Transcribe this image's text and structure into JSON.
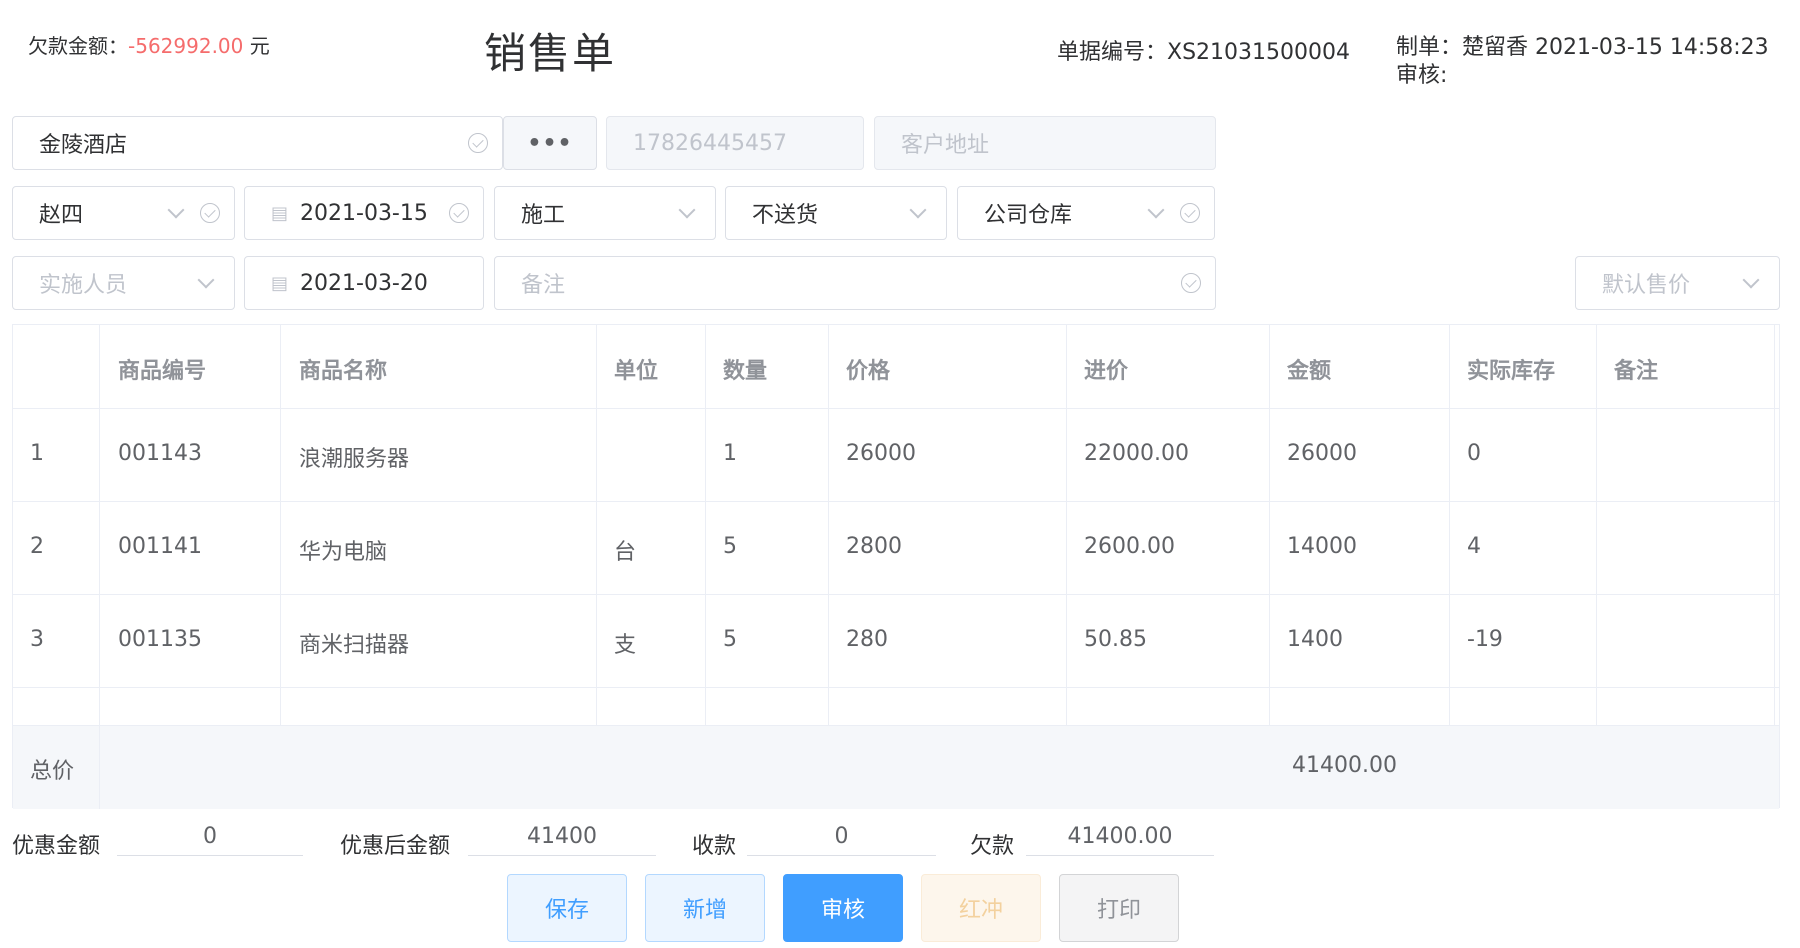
{
  "header": {
    "debt_label": "欠款金额：",
    "debt_value": "-562992.00",
    "debt_unit": " 元",
    "title": "销售单",
    "doc_no": "单据编号：XS21031500004",
    "maker": "制单：楚留香 2021-03-15 14:58:23",
    "auditor": "审核:"
  },
  "form": {
    "customer": "金陵酒店",
    "more_button": "•••",
    "phone_placeholder": "17826445457",
    "address_placeholder": "客户地址",
    "salesperson": "赵四",
    "order_date": "2021-03-15",
    "service_type": "施工",
    "delivery": "不送货",
    "warehouse": "公司仓库",
    "implementer_placeholder": "实施人员",
    "impl_date": "2021-03-20",
    "remark_placeholder": "备注",
    "price_mode_placeholder": "默认售价"
  },
  "table": {
    "headers": [
      "",
      "商品编号",
      "商品名称",
      "单位",
      "数量",
      "价格",
      "进价",
      "金额",
      "实际库存",
      "备注"
    ],
    "rows": [
      [
        "1",
        "001143",
        "浪潮服务器",
        "",
        "1",
        "26000",
        "22000.00",
        "26000",
        "0",
        ""
      ],
      [
        "2",
        "001141",
        "华为电脑",
        "台",
        "5",
        "2800",
        "2600.00",
        "14000",
        "4",
        ""
      ],
      [
        "3",
        "001135",
        "商米扫描器",
        "支",
        "5",
        "280",
        "50.85",
        "1400",
        "-19",
        ""
      ]
    ],
    "total_label": "总价",
    "total_value": "41400.00"
  },
  "summary": {
    "discount_label": "优惠金额",
    "discount_value": "0",
    "after_label": "优惠后金额",
    "after_value": "41400",
    "received_label": "收款",
    "received_value": "0",
    "owed_label": "欠款",
    "owed_value": "41400.00"
  },
  "buttons": {
    "save": "保存",
    "new": "新增",
    "audit": "审核",
    "red_reverse": "红冲",
    "print": "打印"
  },
  "colors": {
    "primary": "#409eff",
    "danger": "#f56c6c",
    "warning_light": "#f3d19e"
  }
}
